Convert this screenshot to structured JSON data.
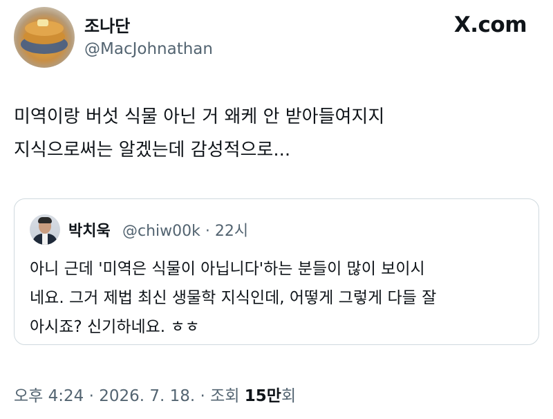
{
  "author": {
    "name": "조나단",
    "handle": "@MacJohnathan"
  },
  "brand": {
    "label": "X.com",
    "icon": "x-logo-icon"
  },
  "tweet": {
    "lines": [
      "미역이랑 버섯 식물 아닌 거 왜케 안 받아들여지지",
      "지식으로써는 알겠는데 감성적으로..."
    ]
  },
  "quoted_tweet": {
    "name": "박치욱",
    "handle": "@chiw00k",
    "separator": "·",
    "time": "22시",
    "lines": [
      "아니 근데 '미역은 식물이 아닙니다'하는 분들이 많이 보이시",
      "네요. 그거 제법 최신 생물학 지식인데, 어떻게 그렇게 다들 잘",
      "아시죠? 신기하네요. ㅎㅎ"
    ]
  },
  "footer": {
    "time": "오후 4:24",
    "sep1": "·",
    "date": "2026. 7. 18.",
    "sep2": "·",
    "views_label": "조회",
    "views_count": "15만",
    "views_suffix": "회"
  },
  "colors": {
    "text": "#0f1419",
    "secondary": "#536471",
    "border": "#cfd9de"
  }
}
